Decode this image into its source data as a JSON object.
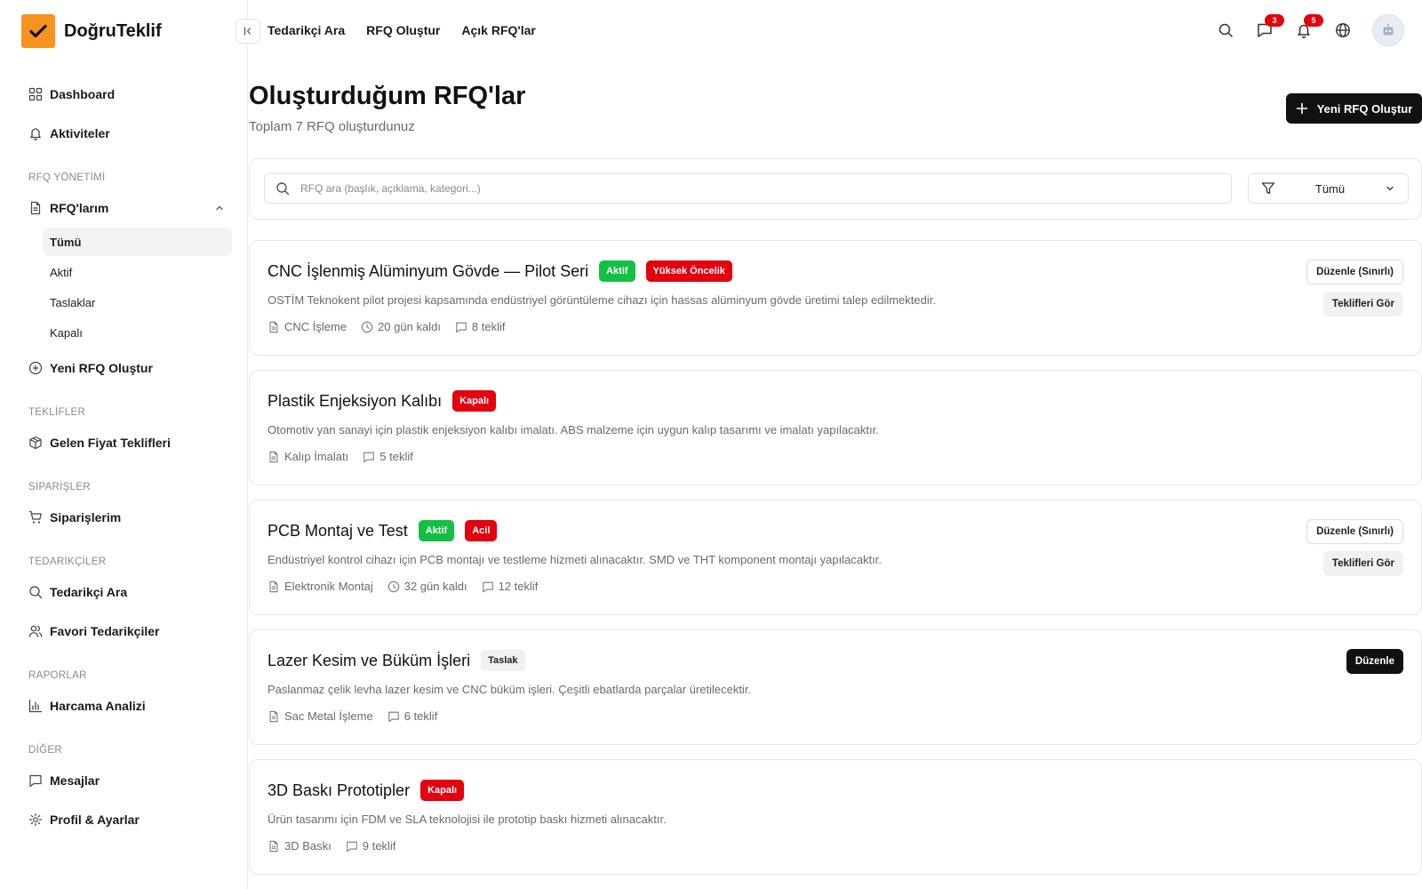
{
  "app": {
    "name": "DoğruTeklif",
    "brand_color": "#f7931e"
  },
  "sidebar": {
    "dashboard": "Dashboard",
    "activities": "Aktiviteler",
    "section_rfq": "RFQ YÖNETİMİ",
    "my_rfqs": "RFQ'larım",
    "sub_items": [
      "Tümü",
      "Aktif",
      "Taslaklar",
      "Kapalı"
    ],
    "active_sub_index": 0,
    "new_rfq": "Yeni RFQ Oluştur",
    "section_offers": "TEKLİFLER",
    "incoming_offers": "Gelen Fiyat Teklifleri",
    "section_orders": "SİPARİŞLER",
    "my_orders": "Siparişlerim",
    "section_suppliers": "TEDARİKÇİLER",
    "search_supplier": "Tedarikçi Ara",
    "favorite_suppliers": "Favori Tedarikçiler",
    "section_reports": "RAPORLAR",
    "spend_analysis": "Harcama Analizi",
    "section_other": "DİĞER",
    "messages": "Mesajlar",
    "profile_settings": "Profil & Ayarlar"
  },
  "topbar": {
    "links": [
      "Tedarikçi Ara",
      "RFQ Oluştur",
      "Açık RFQ'lar"
    ],
    "messages_badge": "3",
    "notifications_badge": "5"
  },
  "main": {
    "title": "Oluşturduğum RFQ'lar",
    "subtitle": "Toplam 7 RFQ oluşturdunuz",
    "new_button": "Yeni RFQ Oluştur",
    "search_placeholder": "RFQ ara (başlık, açıklama, kategori...)",
    "filter_value": "Tümü"
  },
  "rfqs": [
    {
      "title": "CNC İşlenmiş Alüminyum Gövde — Pilot Seri",
      "tags": [
        {
          "label": "Aktif",
          "color": "green"
        },
        {
          "label": "Yüksek Öncelik",
          "color": "red"
        }
      ],
      "description": "OSTİM Teknokent pilot projesi kapsamında endüstriyel görüntüleme cihazı için hassas alüminyum gövde üretimi talep edilmektedir.",
      "category": "CNC İşleme",
      "days_left": "20 gün kaldı",
      "offers": "8 teklif",
      "actions": [
        "Düzenle (Sınırlı)",
        "Teklifleri Gör"
      ]
    },
    {
      "title": "Plastik Enjeksiyon Kalıbı",
      "tags": [
        {
          "label": "Kapalı",
          "color": "red"
        }
      ],
      "description": "Otomotiv yan sanayi için plastik enjeksiyon kalıbı imalatı. ABS malzeme için uygun kalıp tasarımı ve imalatı yapılacaktır.",
      "category": "Kalıp İmalatı",
      "days_left": "",
      "offers": "5 teklif",
      "actions": []
    },
    {
      "title": "PCB Montaj ve Test",
      "tags": [
        {
          "label": "Aktif",
          "color": "green"
        },
        {
          "label": "Acil",
          "color": "red"
        }
      ],
      "description": "Endüstriyel kontrol cihazı için PCB montajı ve testleme hizmeti alınacaktır. SMD ve THT komponent montajı yapılacaktır.",
      "category": "Elektronik Montaj",
      "days_left": "32 gün kaldı",
      "offers": "12 teklif",
      "actions": [
        "Düzenle (Sınırlı)",
        "Teklifleri Gör"
      ]
    },
    {
      "title": "Lazer Kesim ve Büküm İşleri",
      "tags": [
        {
          "label": "Taslak",
          "color": "gray"
        }
      ],
      "description": "Paslanmaz çelik levha lazer kesim ve CNC büküm işleri. Çeşitli ebatlarda parçalar üretilecektir.",
      "category": "Sac Metal İşleme",
      "days_left": "",
      "offers": "6 teklif",
      "actions": [
        "Düzenle"
      ]
    },
    {
      "title": "3D Baskı Prototipler",
      "tags": [
        {
          "label": "Kapalı",
          "color": "red"
        }
      ],
      "description": "Ürün tasarımı için FDM ve SLA teknolojisi ile prototip baskı hizmeti alınacaktır.",
      "category": "3D Baskı",
      "days_left": "",
      "offers": "9 teklif",
      "actions": []
    }
  ]
}
